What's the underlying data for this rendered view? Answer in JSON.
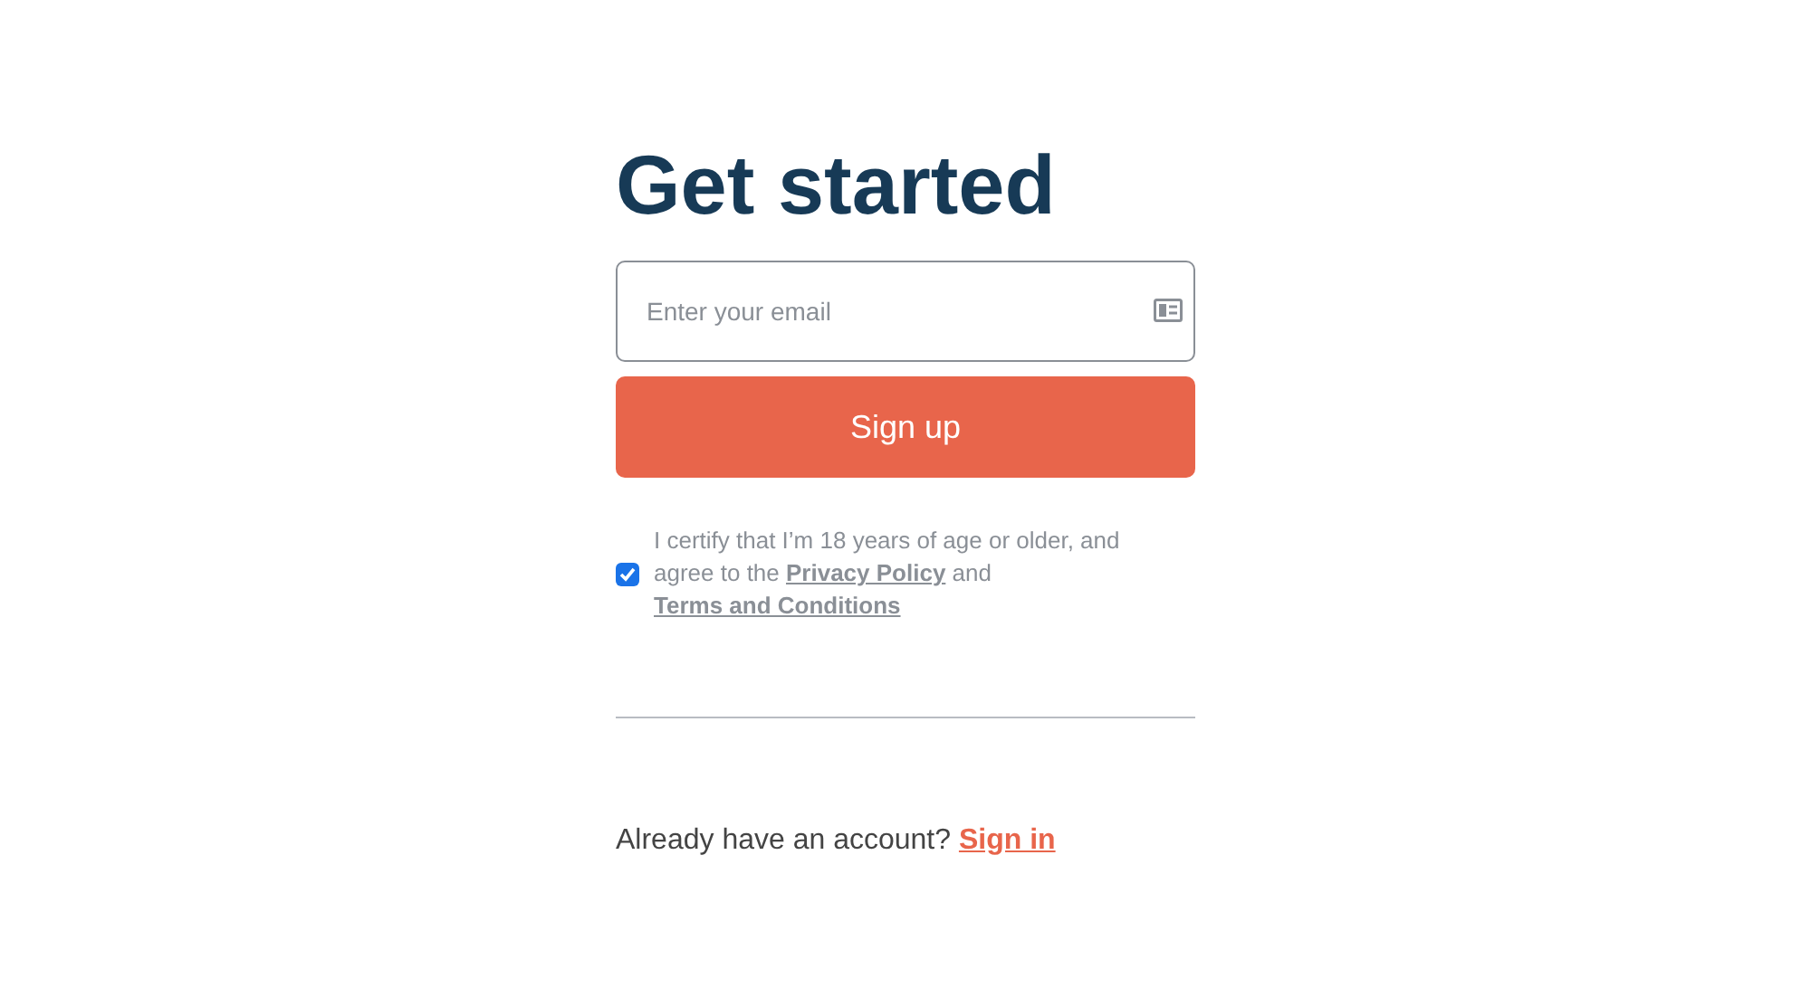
{
  "title": "Get started",
  "email_field": {
    "placeholder": "Enter your email"
  },
  "submit_button": "Sign up",
  "consent": {
    "checked": true,
    "parts": [
      {
        "kind": "text",
        "text": "I certify that I’m 18 years of age or older, and agree to the "
      },
      {
        "kind": "link",
        "text": "Privacy Policy"
      },
      {
        "kind": "text",
        "text": " and "
      },
      {
        "kind": "link",
        "text": "Terms and Conditions"
      }
    ]
  },
  "footer": {
    "text": "Already have an account?",
    "link": "Sign in"
  }
}
